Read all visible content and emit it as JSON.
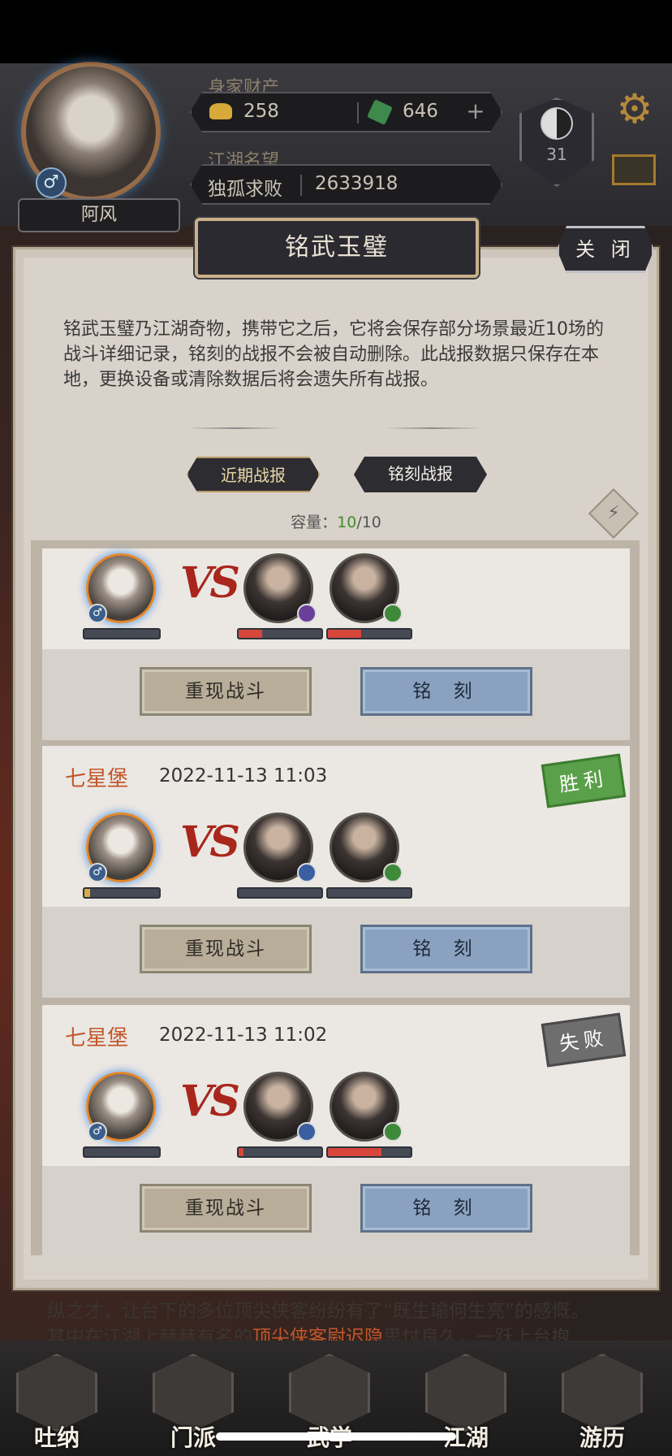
{
  "header": {
    "player_name": "阿风",
    "gender_symbol": "♂",
    "wealth_label": "身家财产",
    "gold": "258",
    "jade": "646",
    "fame_label": "江湖名望",
    "title": "独孤求败",
    "fame_value": "2633918",
    "level": "31"
  },
  "panel": {
    "title": "铭武玉璧",
    "close_label": "关 闭",
    "description": "铭武玉璧乃江湖奇物，携带它之后，它将会保存部分场景最近10场的战斗详细记录，铭刻的战报不会被自动删除。此战报数据只保存在本地，更换设备或清除数据后将会遗失所有战报。",
    "tabs": [
      {
        "label": "近期战报"
      },
      {
        "label": "铭刻战报"
      }
    ],
    "capacity_label": "容量：",
    "capacity_used": "10",
    "capacity_total": "/10"
  },
  "battles": [
    {
      "location": "",
      "time": "",
      "result": "",
      "my_hp": 0.0,
      "enemy_hp": [
        0.28,
        0.4
      ],
      "replay_label": "重现战斗",
      "engrave_label": "铭 刻"
    },
    {
      "location": "七星堡",
      "time": "2022-11-13 11:03",
      "result": "胜利",
      "my_hp": 0.08,
      "enemy_hp": [
        0.0,
        0.0
      ],
      "replay_label": "重现战斗",
      "engrave_label": "铭 刻"
    },
    {
      "location": "七星堡",
      "time": "2022-11-13 11:02",
      "result": "失败",
      "my_hp": 0.0,
      "enemy_hp": [
        0.06,
        0.65
      ],
      "replay_label": "重现战斗",
      "engrave_label": "铭 刻"
    }
  ],
  "vs_label": "VS",
  "bottom_text": {
    "line1": "纵之才，让台下的多位顶尖侠客纷纷有了“既生瑜何生亮”的感慨。",
    "line2_pre": "其中在江湖上赫赫有名的",
    "line2_hl": "顶尖侠客尉迟隐",
    "line2_post": "思忖良久，一跃上台抱"
  },
  "nav": [
    {
      "label": "吐纳"
    },
    {
      "label": "门派"
    },
    {
      "label": "武学"
    },
    {
      "label": "江湖"
    },
    {
      "label": "游历"
    }
  ],
  "colors": {
    "hp_red": "#d6463a",
    "hp_gold": "#d6a94a",
    "accent_orange": "#c2572b",
    "win_green": "#5aa04a"
  }
}
